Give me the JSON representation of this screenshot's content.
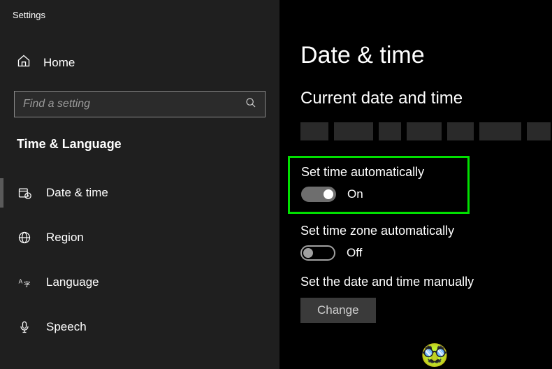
{
  "app_title": "Settings",
  "sidebar": {
    "home_label": "Home",
    "search_placeholder": "Find a setting",
    "category": "Time & Language",
    "items": [
      {
        "label": "Date & time",
        "icon": "calendar-clock-icon",
        "active": true
      },
      {
        "label": "Region",
        "icon": "globe-icon",
        "active": false
      },
      {
        "label": "Language",
        "icon": "language-icon",
        "active": false
      },
      {
        "label": "Speech",
        "icon": "microphone-icon",
        "active": false
      }
    ]
  },
  "main": {
    "page_title": "Date & time",
    "current_section": "Current date and time",
    "toggles": {
      "set_time_auto": {
        "label": "Set time automatically",
        "state_text": "On",
        "on": true,
        "highlighted": true
      },
      "set_tz_auto": {
        "label": "Set time zone automatically",
        "state_text": "Off",
        "on": false,
        "highlighted": false
      }
    },
    "manual": {
      "label": "Set the date and time manually",
      "button": "Change"
    }
  }
}
